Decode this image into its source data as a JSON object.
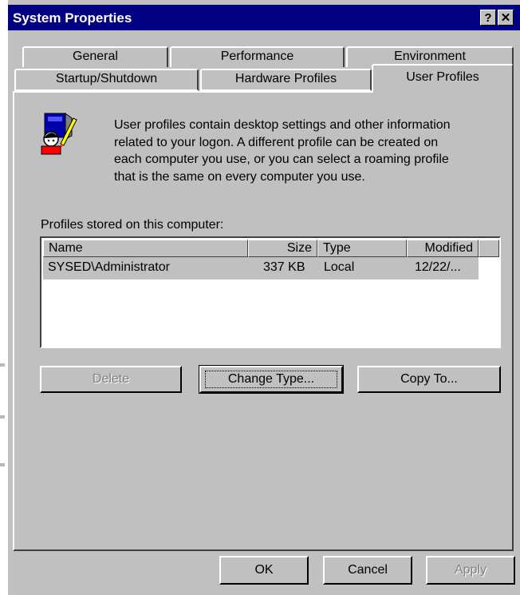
{
  "window": {
    "title": "System Properties",
    "help_glyph": "?",
    "close_glyph": "✕"
  },
  "tabs": {
    "row1": [
      "General",
      "Performance",
      "Environment"
    ],
    "row2": [
      "Startup/Shutdown",
      "Hardware Profiles",
      "User Profiles"
    ],
    "active": "User Profiles"
  },
  "description": [
    "User profiles contain desktop settings and other information",
    "related to your logon.  A different profile can be created on",
    "each computer you use, or you can select a roaming profile",
    "that is the same on every computer you use."
  ],
  "profiles_label": "Profiles stored on this computer:",
  "table": {
    "columns": [
      "Name",
      "Size",
      "Type",
      "Modified"
    ],
    "rows": [
      {
        "name": "SYSED\\Administrator",
        "size": "337 KB",
        "type": "Local",
        "modified": "12/22/..."
      }
    ]
  },
  "buttons": {
    "delete": "Delete",
    "change_type": "Change Type...",
    "copy_to": "Copy To...",
    "ok": "OK",
    "cancel": "Cancel",
    "apply": "Apply"
  },
  "icon": "user-profile-icon"
}
